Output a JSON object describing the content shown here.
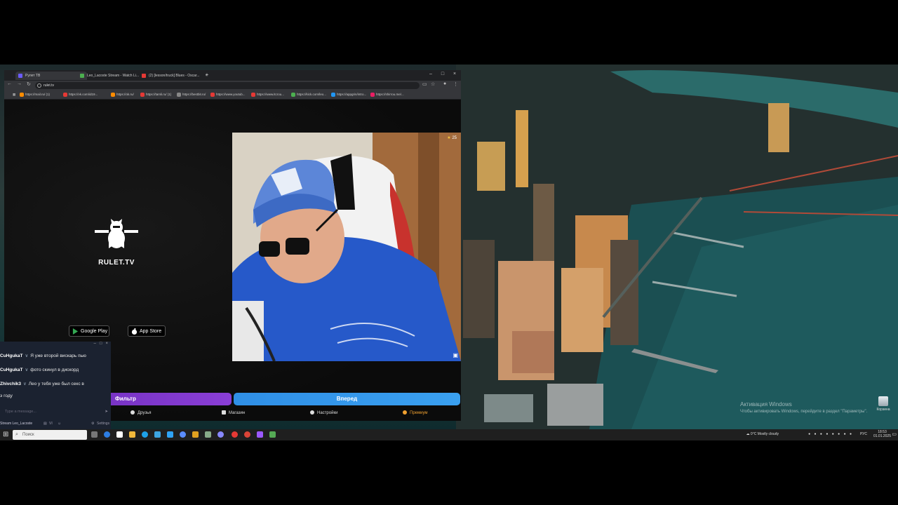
{
  "browser": {
    "tabs": [
      {
        "label": "Рулет ТВ",
        "active": true,
        "fav": "#6b5bff"
      },
      {
        "label": "Leo_Lacoste Stream - Watch Li...",
        "active": false,
        "fav": "#4caf50"
      },
      {
        "label": "(2) [lesson/truck] Blues - Oscar...",
        "active": false,
        "fav": "#e53935"
      }
    ],
    "new_tab": "+",
    "url": "rulet.tv",
    "bookmarks": [
      {
        "label": "https://mail.ru/ (1)",
        "color": "#ff8c00"
      },
      {
        "label": "https://vk.com/id19...",
        "color": "#e53935"
      },
      {
        "label": "https://ok.ru/",
        "color": "#ff8c00"
      },
      {
        "label": "https://tamli.ru/ (1)",
        "color": "#e53935"
      },
      {
        "label": "https://bestbit.ru/",
        "color": "#888888"
      },
      {
        "label": "https://www.youtub...",
        "color": "#e53935"
      },
      {
        "label": "https://www.itcrou...",
        "color": "#e53935"
      },
      {
        "label": "https://kick.com/leo...",
        "color": "#4caf50"
      },
      {
        "label": "https://appgrin/intro...",
        "color": "#2196f3"
      },
      {
        "label": "https://shirrou.me/...",
        "color": "#e91e63"
      }
    ]
  },
  "site": {
    "brand": "RULET.TV",
    "google_play": "Google Play",
    "app_store": "App Store",
    "viewers": "25",
    "left_button": "Фильтр",
    "right_button": "Вперед",
    "nav": [
      {
        "label": "Друзья"
      },
      {
        "label": "Магазин"
      },
      {
        "label": "Настройки"
      },
      {
        "label": "Премиум"
      }
    ]
  },
  "chat": {
    "messages": [
      {
        "user": "CuHgukaT",
        "text": "Я уже второй вискарь пью"
      },
      {
        "user": "CuHgukaT",
        "text": "фото скинул в дискорд"
      },
      {
        "user": "Zhivchik3",
        "text": "Лео у тебя уже был секс в"
      },
      {
        "user": "",
        "text": "э году"
      }
    ],
    "input_placeholder": "Type a message...",
    "footer_left": "Stream Leo_Lacoste",
    "footer_count": "VI",
    "footer_settings": "Settings"
  },
  "desktop": {
    "activation_title": "Активация Windows",
    "activation_sub": "Чтобы активировать Windows, перейдите в раздел \"Параметры\".",
    "recycle_bin": "Корзина"
  },
  "taskbar": {
    "search_placeholder": "Поиск",
    "weather": "0°C Mostly cloudy",
    "lang": "РУС",
    "time": "18:53",
    "date": "01.01.2025"
  }
}
